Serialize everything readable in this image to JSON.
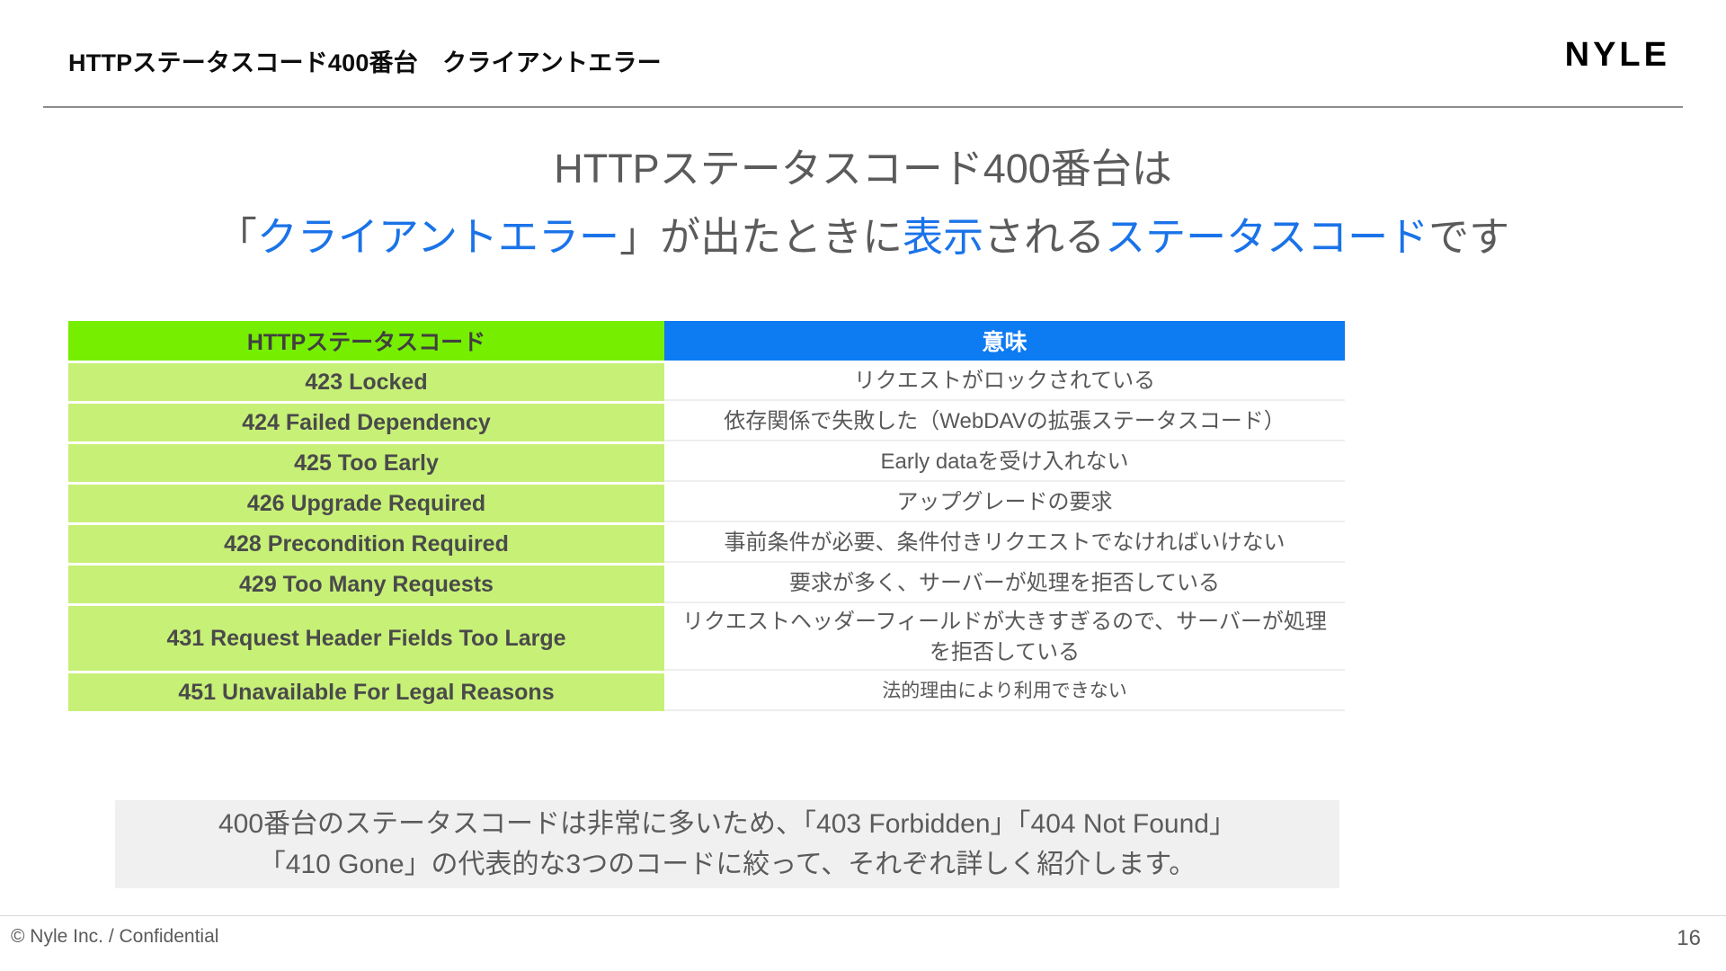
{
  "header": {
    "title": "HTTPステータスコード400番台　クライアントエラー",
    "logo": "NYLE"
  },
  "headline": {
    "line1": "HTTPステータスコード400番台は",
    "line2_part1": "「",
    "line2_part2": "クライアントエラー",
    "line2_part3": "」が出たときに",
    "line2_part4": "表示",
    "line2_part5": "される",
    "line2_part6": "ステータスコード",
    "line2_part7": "です",
    "accent_color": "#1a73e8",
    "text_color": "#5b5b5b"
  },
  "table": {
    "header": {
      "code": "HTTPステータスコード",
      "meaning": "意味",
      "code_bg": "#76ee00",
      "meaning_bg": "#0d7bf2"
    },
    "row_bg": "#c7f077",
    "rows": [
      {
        "code": "423 Locked",
        "meaning": "リクエストがロックされている"
      },
      {
        "code": "424 Failed Dependency",
        "meaning": "依存関係で失敗した（WebDAVの拡張ステータスコード）"
      },
      {
        "code": "425 Too Early",
        "meaning": "Early dataを受け入れない"
      },
      {
        "code": "426 Upgrade Required",
        "meaning": "アップグレードの要求"
      },
      {
        "code": "428 Precondition Required",
        "meaning": "事前条件が必要、条件付きリクエストでなければいけない"
      },
      {
        "code": "429 Too Many Requests",
        "meaning": "要求が多く、サーバーが処理を拒否している"
      },
      {
        "code": "431 Request Header Fields Too Large",
        "meaning": "リクエストヘッダーフィールドが大きすぎるので、サーバーが処理を拒否している"
      },
      {
        "code": "451 Unavailable For Legal Reasons",
        "meaning": "法的理由により利用できない"
      }
    ]
  },
  "note": {
    "line1": "400番台のステータスコードは非常に多いため、「403 Forbidden」「404 Not Found」",
    "line2": "「410 Gone」の代表的な3つのコードに絞って、それぞれ詳しく紹介します。",
    "bg": "#f0f0f0"
  },
  "footer": {
    "copyright": "© Nyle Inc. / Confidential",
    "page_number": "16"
  }
}
